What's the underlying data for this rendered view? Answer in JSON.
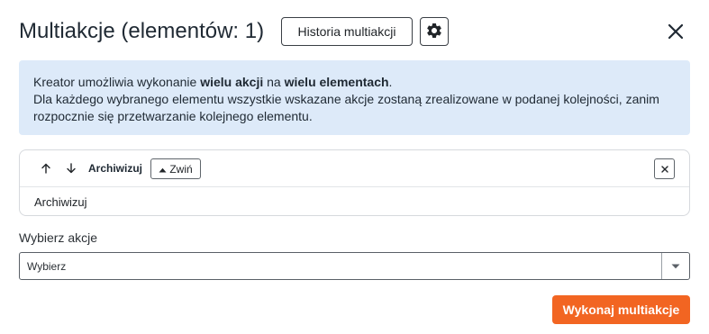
{
  "dialog": {
    "title": "Multiakcje (elementów: 1)",
    "history_button": "Historia multiakcji",
    "settings_icon": "gear-icon",
    "close_icon": "close-icon"
  },
  "info": {
    "line1_a": "Kreator umożliwia wykonanie ",
    "line1_b": "wielu akcji",
    "line1_c": " na ",
    "line1_d": "wielu elementach",
    "line1_e": ".",
    "line2": "Dla każdego wybranego elementu wszystkie wskazane akcje zostaną zrealizowane w podanej kolejności, zanim rozpocznie się przetwarzanie kolejnego elementu."
  },
  "actions": [
    {
      "name": "Archiwizuj",
      "collapse_label": "Zwiń",
      "body_text": "Archiwizuj"
    }
  ],
  "select": {
    "label": "Wybierz akcje",
    "value": "Wybierz"
  },
  "footer": {
    "run_button": "Wykonaj multiakcje"
  },
  "colors": {
    "accent": "#f26522",
    "info_bg": "#ddeaf9"
  }
}
